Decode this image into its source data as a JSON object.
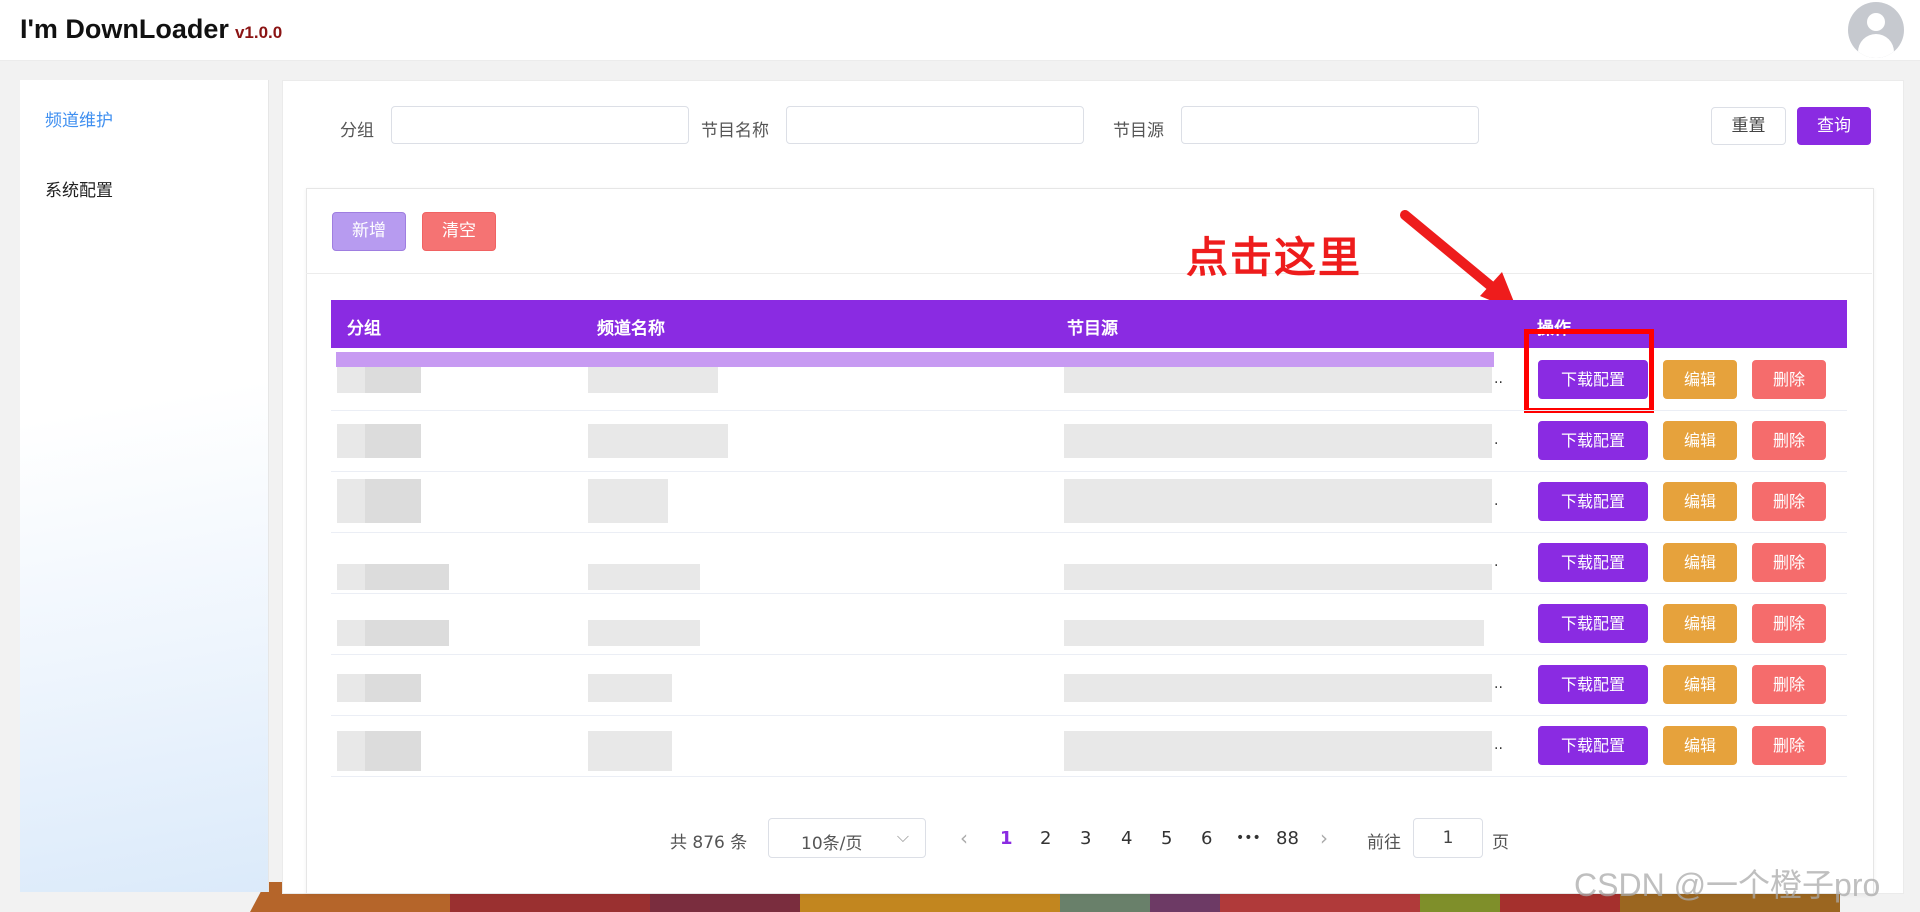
{
  "app": {
    "title": "I'm DownLoader",
    "version": "v1.0.0"
  },
  "sidebar": {
    "items": [
      {
        "label": "频道维护"
      },
      {
        "label": "系统配置"
      }
    ]
  },
  "search": {
    "group_label": "分组",
    "name_label": "节目名称",
    "source_label": "节目源",
    "reset_label": "重置",
    "query_label": "查询"
  },
  "toolbar": {
    "add_label": "新增",
    "clear_label": "清空"
  },
  "annotation": {
    "text": "点击这里"
  },
  "table": {
    "columns": [
      "分组",
      "频道名称",
      "节目源",
      "操作"
    ],
    "row_actions": {
      "download": "下载配置",
      "edit": "编辑",
      "delete": "删除"
    },
    "rows": [
      {
        "source_suffix": ".."
      },
      {
        "source_suffix": "."
      },
      {
        "source_suffix": "."
      },
      {
        "source_suffix": "."
      },
      {
        "source_suffix": ""
      },
      {
        "source_suffix": ".."
      },
      {
        "source_suffix": ".."
      }
    ]
  },
  "pagination": {
    "total": "共 876 条",
    "page_size": "10条/页",
    "pages": [
      "1",
      "2",
      "3",
      "4",
      "5",
      "6",
      "•••",
      "88"
    ],
    "current": "1",
    "prev": "‹",
    "next": "›",
    "goto_label": "前往",
    "goto_value": "1",
    "page_unit": "页"
  },
  "watermark": "CSDN @一个橙子pro",
  "colors": {
    "primary": "#8a2be2",
    "warning": "#e6a23c",
    "danger": "#f56c6c",
    "annotation": "#ee1c1c"
  }
}
